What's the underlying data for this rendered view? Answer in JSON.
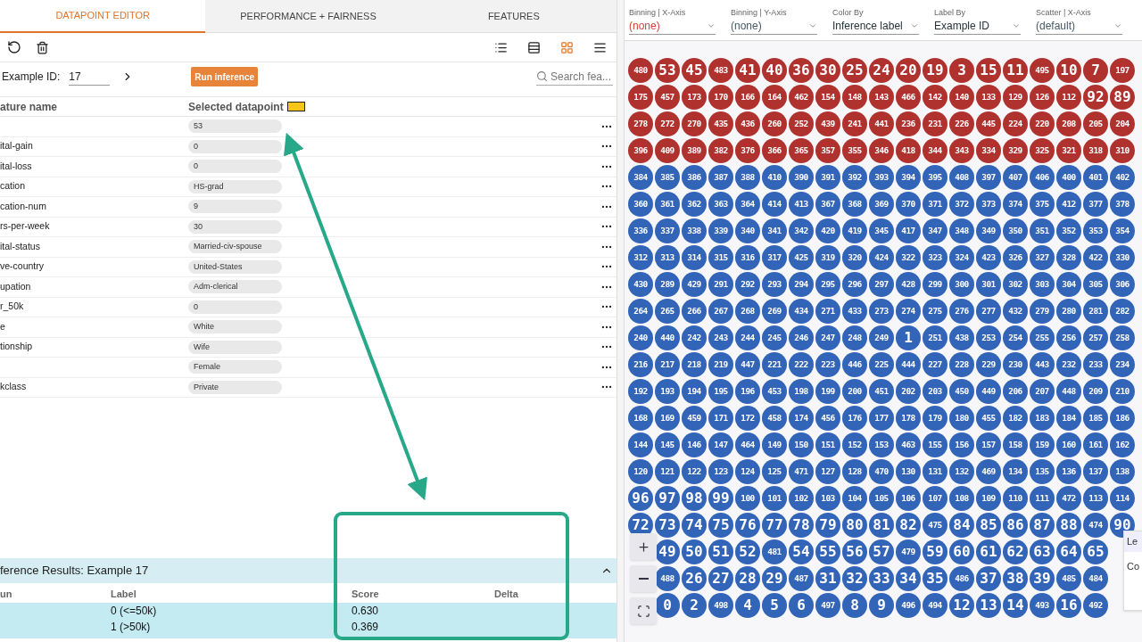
{
  "tabs": [
    {
      "label": "DATAPOINT EDITOR",
      "selected": true
    },
    {
      "label": "PERFORMANCE + FAIRNESS",
      "selected": false
    },
    {
      "label": "FEATURES",
      "selected": false
    }
  ],
  "view_toggles": [
    {
      "kind": "list",
      "selected": false
    },
    {
      "kind": "rows",
      "selected": false
    },
    {
      "kind": "grid",
      "selected": true
    },
    {
      "kind": "lines",
      "selected": false
    }
  ],
  "example": {
    "label": "Example ID:",
    "value": "17",
    "button": "Run inference",
    "search_placeholder": "Search fea..."
  },
  "features": {
    "columns": [
      "ature name",
      "Selected datapoint"
    ],
    "rows": [
      {
        "name": null,
        "value": "53"
      },
      {
        "name": "ital-gain",
        "value": "0"
      },
      {
        "name": "ital-loss",
        "value": "0"
      },
      {
        "name": "cation",
        "value": "HS-grad"
      },
      {
        "name": "cation-num",
        "value": "9"
      },
      {
        "name": "rs-per-week",
        "value": "30"
      },
      {
        "name": "ital-status",
        "value": "Married-civ-spouse"
      },
      {
        "name": "ve-country",
        "value": "United-States"
      },
      {
        "name": "upation",
        "value": "Adm-clerical"
      },
      {
        "name": "r_50k",
        "value": "0"
      },
      {
        "name": "e",
        "value": "White"
      },
      {
        "name": "tionship",
        "value": "Wife"
      },
      {
        "name": null,
        "value": "Female"
      },
      {
        "name": "kclass",
        "value": "Private"
      }
    ]
  },
  "inference": {
    "title": "ference Results: Example 17",
    "expanded": true,
    "columns": [
      "un",
      "Label",
      "Score",
      "Delta"
    ],
    "rows": [
      {
        "label": "0 (<=50k)",
        "score": "0.630"
      },
      {
        "label": "1 (>50k)",
        "score": "0.369"
      }
    ]
  },
  "controls": [
    {
      "label": "Binning | X-Axis",
      "value": "(none)",
      "color": "#d0453b"
    },
    {
      "label": "Binning | Y-Axis",
      "value": "(none)",
      "color": "#455a64"
    },
    {
      "label": "Color By",
      "value": "Inference label",
      "color": "#263238"
    },
    {
      "label": "Label By",
      "value": "Example ID",
      "color": "#263238"
    },
    {
      "label": "Scatter | X-Axis",
      "value": "(default)",
      "color": "#455a64"
    }
  ],
  "grid": [
    {
      "color": "#b0322f",
      "cells": [
        "480",
        "53",
        "45",
        "483",
        "41",
        "40",
        "36",
        "30",
        "25",
        "24",
        "20",
        "19",
        "3",
        "15",
        "11",
        "495",
        "10",
        "7",
        "197"
      ]
    },
    {
      "color": "#b0322f",
      "cells": [
        "175",
        "457",
        "173",
        "170",
        "166",
        "164",
        "462",
        "154",
        "148",
        "143",
        "466",
        "142",
        "140",
        "133",
        "129",
        "126",
        "112",
        "92",
        "89"
      ]
    },
    {
      "color": "#b0322f",
      "cells": [
        "278",
        "272",
        "270",
        "435",
        "436",
        "260",
        "252",
        "439",
        "241",
        "441",
        "236",
        "231",
        "226",
        "445",
        "224",
        "220",
        "208",
        "205",
        "204"
      ]
    },
    {
      "color": "#b0322f",
      "cells": [
        "396",
        "409",
        "389",
        "382",
        "376",
        "366",
        "365",
        "357",
        "355",
        "346",
        "418",
        "344",
        "343",
        "334",
        "329",
        "325",
        "321",
        "318",
        "310"
      ]
    },
    {
      "color": "#3264b8",
      "cells": [
        "384",
        "385",
        "386",
        "387",
        "388",
        "410",
        "390",
        "391",
        "392",
        "393",
        "394",
        "395",
        "408",
        "397",
        "407",
        "406",
        "400",
        "401",
        "402"
      ]
    },
    {
      "color": "#3264b8",
      "cells": [
        "360",
        "361",
        "362",
        "363",
        "364",
        "414",
        "413",
        "367",
        "368",
        "369",
        "370",
        "371",
        "372",
        "373",
        "374",
        "375",
        "412",
        "377",
        "378"
      ]
    },
    {
      "color": "#3264b8",
      "cells": [
        "336",
        "337",
        "338",
        "339",
        "340",
        "341",
        "342",
        "420",
        "419",
        "345",
        "417",
        "347",
        "348",
        "349",
        "350",
        "351",
        "352",
        "353",
        "354"
      ]
    },
    {
      "color": "#3264b8",
      "cells": [
        "312",
        "313",
        "314",
        "315",
        "316",
        "317",
        "425",
        "319",
        "320",
        "424",
        "322",
        "323",
        "324",
        "423",
        "326",
        "327",
        "328",
        "422",
        "330"
      ]
    },
    {
      "color": "#3264b8",
      "cells": [
        "430",
        "289",
        "429",
        "291",
        "292",
        "293",
        "294",
        "295",
        "296",
        "297",
        "428",
        "299",
        "300",
        "301",
        "302",
        "303",
        "304",
        "305",
        "306"
      ]
    },
    {
      "color": "#3264b8",
      "cells": [
        "264",
        "265",
        "266",
        "267",
        "268",
        "269",
        "434",
        "271",
        "433",
        "273",
        "274",
        "275",
        "276",
        "277",
        "432",
        "279",
        "280",
        "281",
        "282"
      ]
    },
    {
      "color": "#3264b8",
      "cells": [
        "240",
        "440",
        "242",
        "243",
        "244",
        "245",
        "246",
        "247",
        "248",
        "249",
        "1",
        "251",
        "438",
        "253",
        "254",
        "255",
        "256",
        "257",
        "258"
      ]
    },
    {
      "color": "#3264b8",
      "cells": [
        "216",
        "217",
        "218",
        "219",
        "447",
        "221",
        "222",
        "223",
        "446",
        "225",
        "444",
        "227",
        "228",
        "229",
        "230",
        "443",
        "232",
        "233",
        "234"
      ]
    },
    {
      "color": "#3264b8",
      "cells": [
        "192",
        "193",
        "194",
        "195",
        "196",
        "453",
        "198",
        "199",
        "200",
        "451",
        "202",
        "203",
        "450",
        "449",
        "206",
        "207",
        "448",
        "209",
        "210"
      ]
    },
    {
      "color": "#3264b8",
      "cells": [
        "168",
        "169",
        "459",
        "171",
        "172",
        "458",
        "174",
        "456",
        "176",
        "177",
        "178",
        "179",
        "180",
        "455",
        "182",
        "183",
        "184",
        "185",
        "186"
      ]
    },
    {
      "color": "#3264b8",
      "cells": [
        "144",
        "145",
        "146",
        "147",
        "464",
        "149",
        "150",
        "151",
        "152",
        "153",
        "463",
        "155",
        "156",
        "157",
        "158",
        "159",
        "160",
        "161",
        "162"
      ]
    },
    {
      "color": "#3264b8",
      "cells": [
        "120",
        "121",
        "122",
        "123",
        "124",
        "125",
        "471",
        "127",
        "128",
        "470",
        "130",
        "131",
        "132",
        "469",
        "134",
        "135",
        "136",
        "137",
        "138"
      ]
    },
    {
      "color": "#3264b8",
      "cells": [
        "96",
        "97",
        "98",
        "99",
        "100",
        "101",
        "102",
        "103",
        "104",
        "105",
        "106",
        "107",
        "108",
        "109",
        "110",
        "111",
        "472",
        "113",
        "114"
      ]
    },
    {
      "color": "#3264b8",
      "cells": [
        "72",
        "73",
        "74",
        "75",
        "76",
        "77",
        "78",
        "79",
        "80",
        "81",
        "82",
        "475",
        "84",
        "85",
        "86",
        "87",
        "88",
        "474",
        "90"
      ]
    },
    {
      "color": "#3264b8",
      "cells": [
        null,
        "49",
        "50",
        "51",
        "52",
        "481",
        "54",
        "55",
        "56",
        "57",
        "479",
        "59",
        "60",
        "61",
        "62",
        "63",
        "64",
        "65",
        null
      ]
    },
    {
      "color": "#3264b8",
      "cells": [
        null,
        "488",
        "26",
        "27",
        "28",
        "29",
        "487",
        "31",
        "32",
        "33",
        "34",
        "35",
        "486",
        "37",
        "38",
        "39",
        "485",
        "484",
        null
      ]
    },
    {
      "color": "#3264b8",
      "cells": [
        null,
        "0",
        "2",
        "498",
        "4",
        "5",
        "6",
        "497",
        "8",
        "9",
        "496",
        "494",
        "12",
        "13",
        "14",
        "493",
        "16",
        "492",
        null
      ]
    }
  ],
  "zoom_buttons": [
    {
      "kind": "plus"
    },
    {
      "kind": "minus"
    },
    {
      "kind": "fit"
    }
  ],
  "legend": {
    "title": "Le",
    "subtitle": "Co"
  }
}
